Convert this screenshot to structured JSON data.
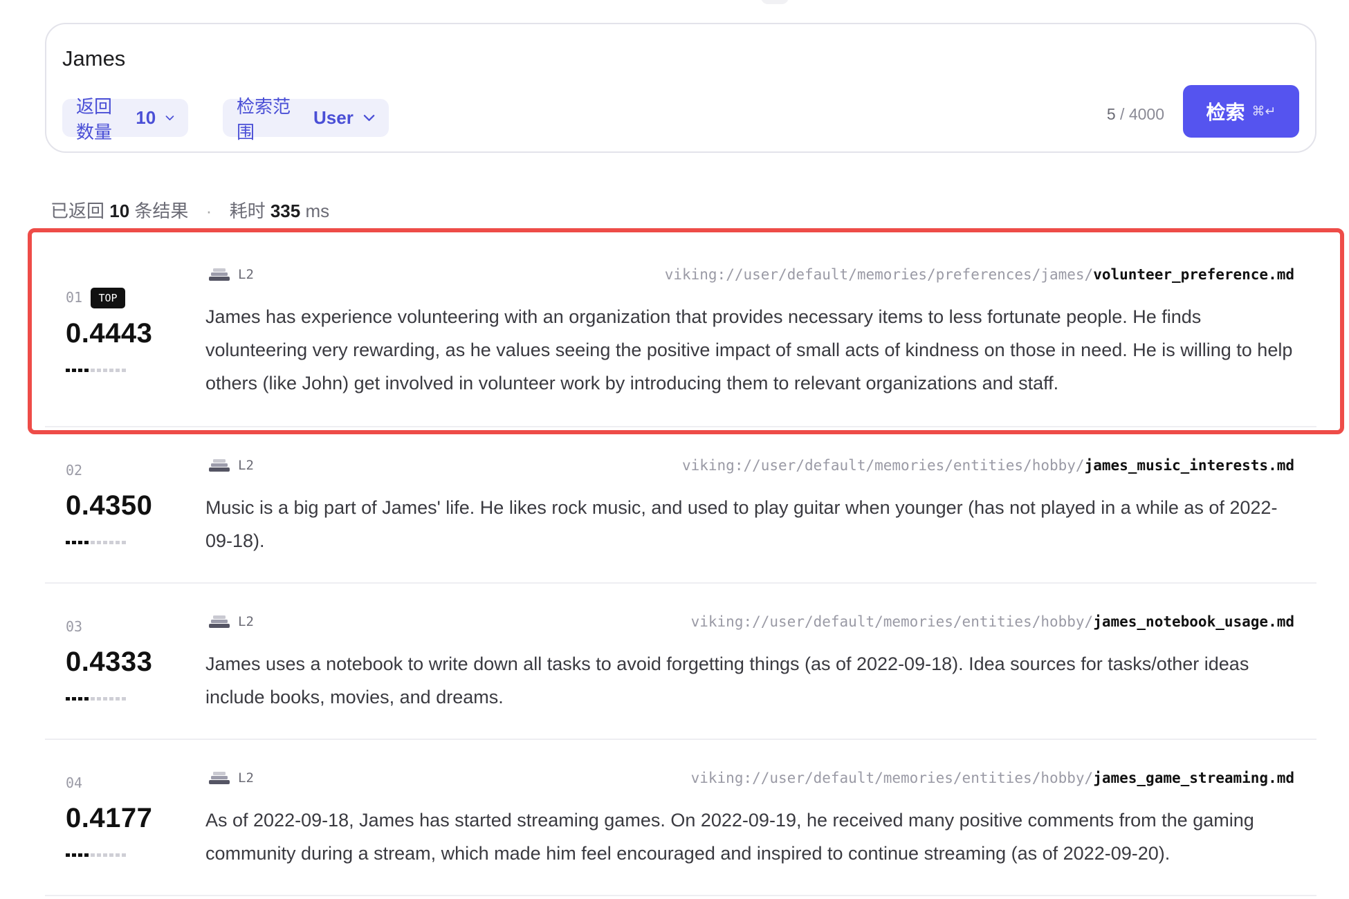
{
  "search": {
    "query": "James",
    "count_label": "返回数量",
    "count_value": "10",
    "scope_label": "检索范围",
    "scope_value": "User",
    "char_current": "5",
    "char_max": "/ 4000",
    "button_label": "检索",
    "button_shortcut": "⌘↵"
  },
  "summary": {
    "prefix": "已返回",
    "count": "10",
    "suffix": "条结果",
    "time_label": "耗时",
    "time_value": "335",
    "time_unit": "ms"
  },
  "colors": {
    "accent": "#5554ef",
    "highlight_border": "#ee4c48"
  },
  "results": [
    {
      "rank": "01",
      "badge": "TOP",
      "score": "0.4443",
      "score_dots_filled": 4,
      "score_dots_total": 10,
      "level": "L2",
      "uri_prefix": "viking://user/default/memories/preferences/james/",
      "uri_file": "volunteer_preference.md",
      "text": "James has experience volunteering with an organization that provides necessary items to less fortunate people. He finds volunteering very rewarding, as he values seeing the positive impact of small acts of kindness on those in need. He is willing to help others (like John) get involved in volunteer work by introducing them to relevant organizations and staff."
    },
    {
      "rank": "02",
      "score": "0.4350",
      "score_dots_filled": 4,
      "score_dots_total": 10,
      "level": "L2",
      "uri_prefix": "viking://user/default/memories/entities/hobby/",
      "uri_file": "james_music_interests.md",
      "text": "Music is a big part of James' life. He likes rock music, and used to play guitar when younger (has not played in a while as of 2022-09-18)."
    },
    {
      "rank": "03",
      "score": "0.4333",
      "score_dots_filled": 4,
      "score_dots_total": 10,
      "level": "L2",
      "uri_prefix": "viking://user/default/memories/entities/hobby/",
      "uri_file": "james_notebook_usage.md",
      "text": "James uses a notebook to write down all tasks to avoid forgetting things (as of 2022-09-18). Idea sources for tasks/other ideas include books, movies, and dreams."
    },
    {
      "rank": "04",
      "score": "0.4177",
      "score_dots_filled": 4,
      "score_dots_total": 10,
      "level": "L2",
      "uri_prefix": "viking://user/default/memories/entities/hobby/",
      "uri_file": "james_game_streaming.md",
      "text": "As of 2022-09-18, James has started streaming games. On 2022-09-19, he received many positive comments from the gaming community during a stream, which made him feel encouraged and inspired to continue streaming (as of 2022-09-20)."
    }
  ]
}
